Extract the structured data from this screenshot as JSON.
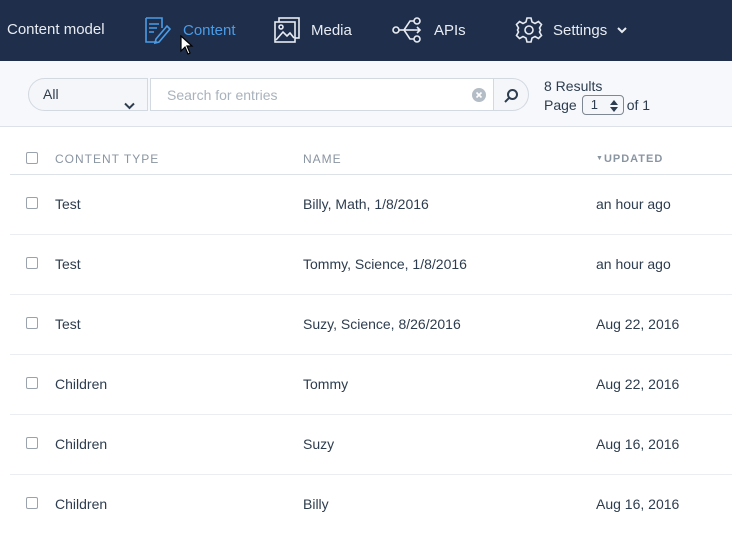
{
  "nav": {
    "content_model": "Content model",
    "content": "Content",
    "media": "Media",
    "apis": "APIs",
    "settings": "Settings",
    "active_color": "#4a9ce8",
    "bg_color": "#1f2f4b"
  },
  "toolbar": {
    "content_type_value": "All",
    "search_placeholder": "Search for entries",
    "search_value": "",
    "results_text": "8 Results",
    "page_label": "Page",
    "page_value": "1",
    "page_of": "of 1"
  },
  "table": {
    "headers": {
      "content_type": "CONTENT TYPE",
      "name": "NAME",
      "updated": "UPDATED"
    },
    "sort": {
      "column": "updated",
      "direction": "desc"
    },
    "rows": [
      {
        "content_type": "Test",
        "name": "Billy, Math, 1/8/2016",
        "updated": "an hour ago"
      },
      {
        "content_type": "Test",
        "name": "Tommy, Science, 1/8/2016",
        "updated": "an hour ago"
      },
      {
        "content_type": "Test",
        "name": "Suzy, Science, 8/26/2016",
        "updated": "Aug 22, 2016"
      },
      {
        "content_type": "Children",
        "name": "Tommy",
        "updated": "Aug 22, 2016"
      },
      {
        "content_type": "Children",
        "name": "Suzy",
        "updated": "Aug 16, 2016"
      },
      {
        "content_type": "Children",
        "name": "Billy",
        "updated": "Aug 16, 2016"
      }
    ]
  }
}
